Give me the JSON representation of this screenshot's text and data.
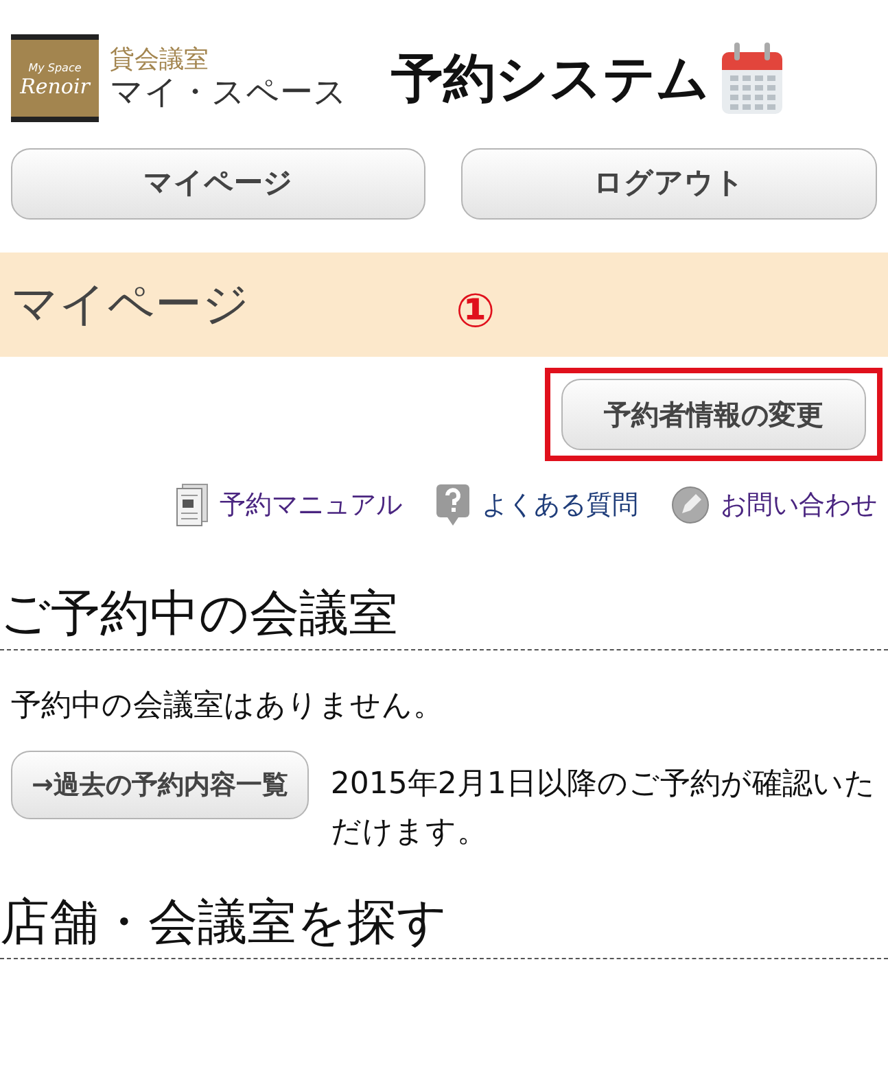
{
  "header": {
    "logo": {
      "tagline": "My Space",
      "brand": "Renoir"
    },
    "subtitle": "貸会議室",
    "name": "マイ・スペース",
    "title": "予約システム"
  },
  "nav_buttons": [
    "マイページ",
    "ログアウト"
  ],
  "page_title": "マイページ",
  "annotation": {
    "mark": "①"
  },
  "profile_button": {
    "label": "予約者情報の変更",
    "highlighted": true
  },
  "links": [
    {
      "kind": "manual",
      "label": "予約マニュアル"
    },
    {
      "kind": "faq",
      "label": "よくある質問"
    },
    {
      "kind": "contact",
      "label": "お問い合わせ"
    }
  ],
  "sections": [
    {
      "heading": "ご予約中の会議室",
      "message": "予約中の会議室はありません。",
      "history_button": "→過去の予約内容一覧",
      "note": "2015年2月1日以降のご予約が確認いただけます。"
    },
    {
      "heading": "店舗・会議室を探す"
    }
  ]
}
